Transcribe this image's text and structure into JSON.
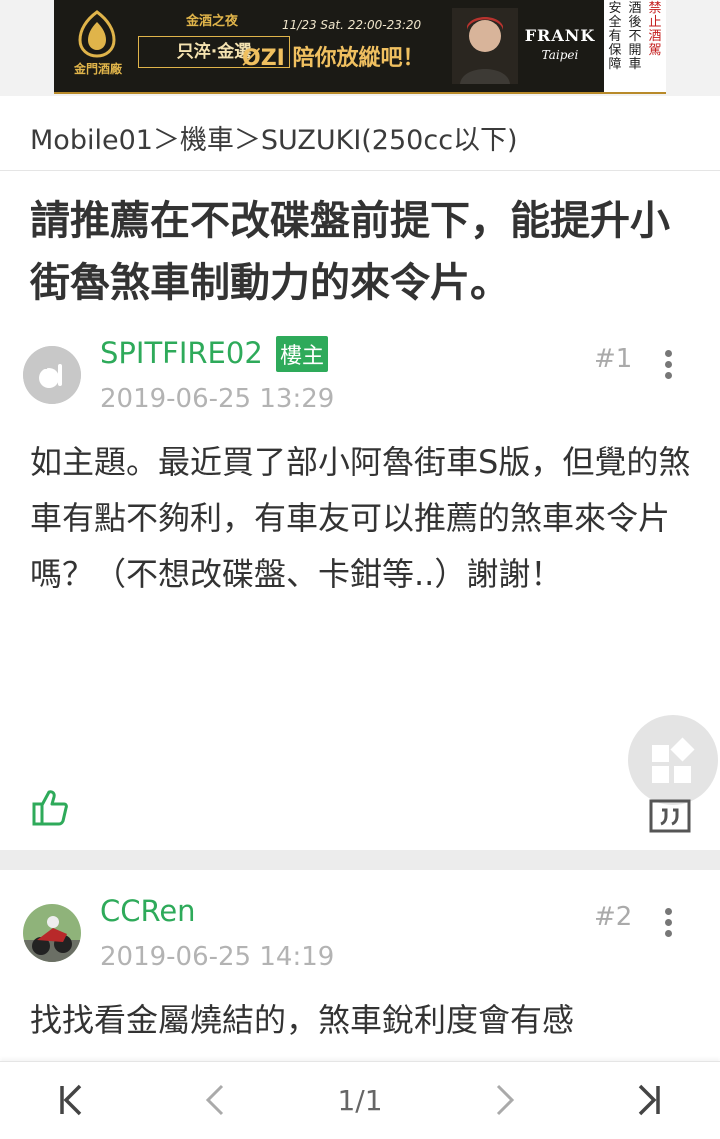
{
  "ad": {
    "logo_text": "金門酒廠",
    "event": "金酒之夜",
    "event2": "只淬·金選",
    "date": "11/23 Sat. 22:00-23:20",
    "slogan": "ØZI 陪你放縱吧！",
    "brand": "FRANK",
    "brand_sub": "Taipei",
    "warning_cols": [
      "禁止酒駕",
      "酒後不開車",
      "安全有保障"
    ]
  },
  "breadcrumb": "Mobile01＞機車＞SUZUKI(250cc以下)",
  "thread_title": "請推薦在不改碟盤前提下，能提升小街魯煞車制動力的來令片。",
  "posts": [
    {
      "username": "SPITFIRE02",
      "badge": "樓主",
      "timestamp": "2019-06-25 13:29",
      "floor": "#1",
      "body": "如主題。最近買了部小阿魯街車S版，但覺的煞車有點不夠利，有車友可以推薦的煞車來令片嗎？（不想改碟盤、卡鉗等..）謝謝！"
    },
    {
      "username": "CCRen",
      "timestamp": "2019-06-25 14:19",
      "floor": "#2",
      "body": "找找看金屬燒結的，煞車銳利度會有感"
    }
  ],
  "pager": {
    "page_indicator": "1/1"
  },
  "colors": {
    "accent_green": "#2eaa5a",
    "muted_gray": "#b3b3b3"
  }
}
